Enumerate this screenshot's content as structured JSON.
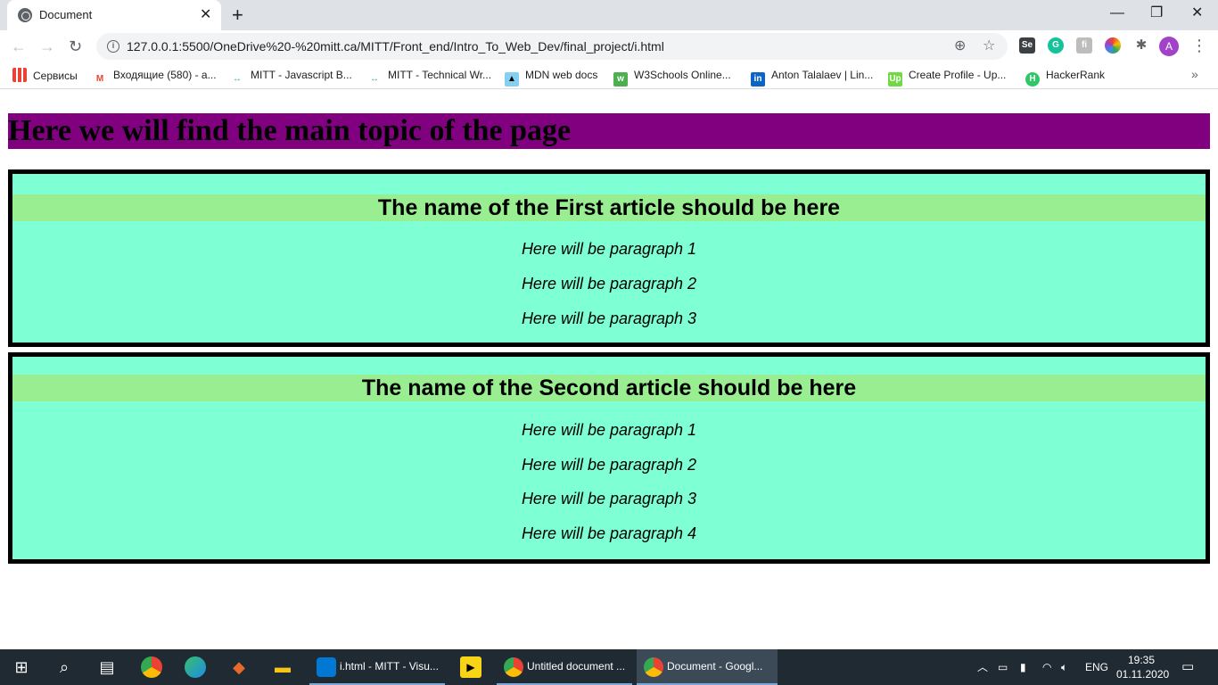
{
  "browser": {
    "tab": {
      "title": "Document",
      "close": "✕"
    },
    "new_tab": "+",
    "window_controls": {
      "minimize": "—",
      "restore": "❐",
      "close": "✕"
    },
    "nav": {
      "back": "←",
      "forward": "→",
      "reload": "↻"
    },
    "url": "127.0.0.1:5500/OneDrive%20-%20mitt.ca/MITT/Front_end/Intro_To_Web_Dev/final_project/i.html",
    "omnibox_icons": {
      "zoom": "⊕",
      "star": "☆"
    },
    "profile_initial": "A",
    "menu": "⋮",
    "bookmarks": [
      {
        "label": "Сервисы",
        "icon": "apps-grid-icon"
      },
      {
        "label": "Входящие (580) - a...",
        "icon": "gmail-icon"
      },
      {
        "label": "MITT - Javascript B...",
        "icon": "mitt-icon"
      },
      {
        "label": "MITT - Technical Wr...",
        "icon": "mitt-icon"
      },
      {
        "label": "MDN web docs",
        "icon": "mdn-icon"
      },
      {
        "label": "W3Schools Online...",
        "icon": "w3schools-icon"
      },
      {
        "label": "Anton Talalaev | Lin...",
        "icon": "linkedin-icon"
      },
      {
        "label": "Create Profile - Up...",
        "icon": "upwork-icon"
      },
      {
        "label": "HackerRank",
        "icon": "hackerrank-icon"
      }
    ],
    "bookmarks_more": "»"
  },
  "page": {
    "main_title": "Here we will find the main topic of the page",
    "articles": [
      {
        "title": "The name of the First article should be here",
        "paragraphs": [
          "Here will be paragraph 1",
          "Here will be paragraph 2",
          "Here will be paragraph 3"
        ]
      },
      {
        "title": "The name of the Second article should be here",
        "paragraphs": [
          "Here will be paragraph 1",
          "Here will be paragraph 2",
          "Here will be paragraph 3",
          "Here will be paragraph 4"
        ]
      }
    ],
    "colors": {
      "title_bg": "#800080",
      "article_bg": "#7fffd4",
      "heading_bg": "#98ee90",
      "border": "#000000"
    }
  },
  "taskbar": {
    "apps": [
      {
        "label": "i.html - MITT - Visu...",
        "icon": "vscode-icon"
      },
      {
        "label": "Untitled document ...",
        "icon": "chrome-icon"
      },
      {
        "label": "Document - Googl...",
        "icon": "chrome-icon",
        "active": true
      }
    ],
    "language": "ENG",
    "time": "19:35",
    "date": "01.11.2020"
  }
}
